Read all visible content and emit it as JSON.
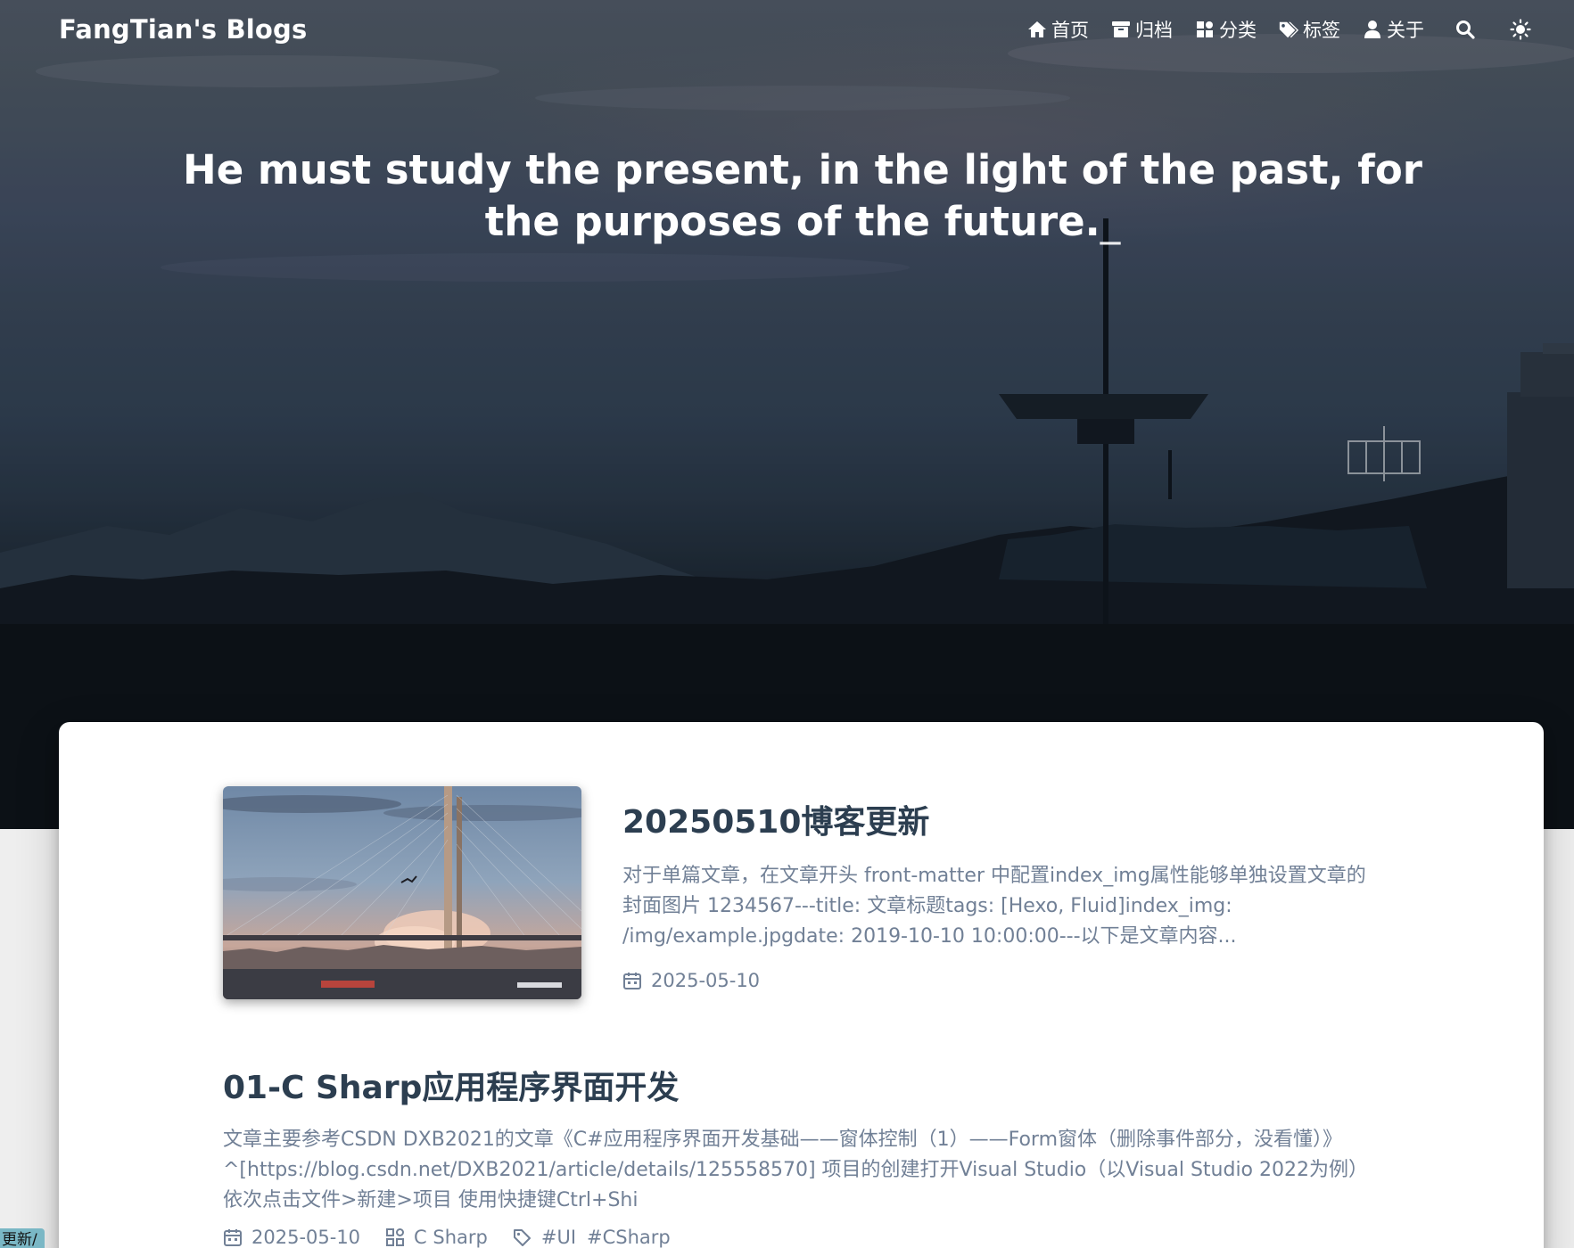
{
  "site": {
    "brand": "FangTian's Blogs"
  },
  "nav": {
    "items": [
      {
        "label": "首页",
        "icon": "home-icon"
      },
      {
        "label": "归档",
        "icon": "archive-icon"
      },
      {
        "label": "分类",
        "icon": "category-icon"
      },
      {
        "label": "标签",
        "icon": "tags-icon"
      },
      {
        "label": "关于",
        "icon": "user-icon"
      }
    ],
    "search_icon": "search-icon",
    "theme_icon": "sun-icon"
  },
  "hero": {
    "slogan": "He must study the present, in the light of the past, for the purposes of the future.",
    "cursor": "_"
  },
  "posts": [
    {
      "title": "20250510博客更新",
      "excerpt": "对于单篇文章，在文章开头 front-matter 中配置index_img属性能够单独设置文章的封面图片 1234567---title: 文章标题tags: [Hexo, Fluid]index_img: /img/example.jpgdate: 2019-10-10 10:00:00---以下是文章内容...",
      "date": "2025-05-10",
      "has_cover": true
    },
    {
      "title": "01-C Sharp应用程序界面开发",
      "excerpt": "文章主要参考CSDN DXB2021的文章《C#应用程序界面开发基础——窗体控制（1）——Form窗体（删除事件部分，没看懂）》^[https://blog.csdn.net/DXB2021/article/details/125558570] 项目的创建打开Visual Studio（以Visual Studio 2022为例） 依次点击文件>新建>项目 使用快捷键Ctrl+Shi",
      "date": "2025-05-10",
      "category": "C Sharp",
      "tags": [
        "#UI",
        "#CSharp"
      ]
    }
  ],
  "floating_tag": {
    "label": "更新/"
  },
  "colors": {
    "title": "#2c3e50",
    "muted": "#718096",
    "board_bg": "#ffffff",
    "page_bg": "#eeeeee",
    "float_tag_bg": "#7ab7c5"
  }
}
